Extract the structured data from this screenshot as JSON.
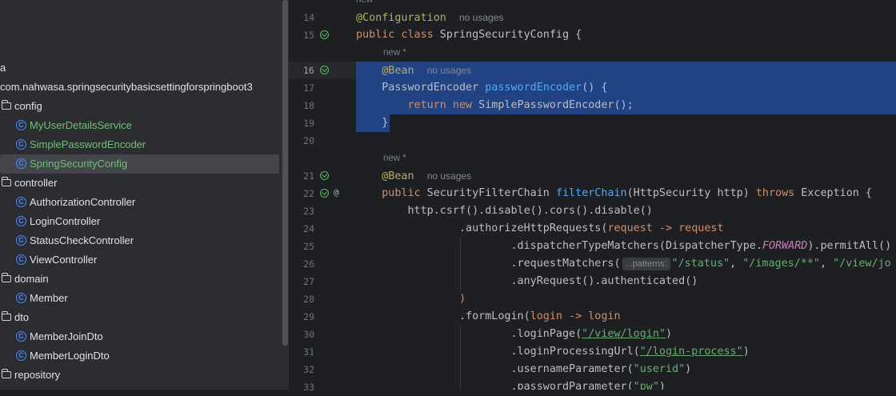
{
  "project_tree": {
    "root_fragment": "a",
    "package": "com.nahwasa.springsecuritybasicsettingforspringboot3",
    "items": [
      {
        "kind": "folder",
        "label": "config"
      },
      {
        "kind": "class",
        "label": "MyUserDetailsService",
        "color": "#73bd79"
      },
      {
        "kind": "class",
        "label": "SimplePasswordEncoder",
        "color": "#73bd79"
      },
      {
        "kind": "class",
        "label": "SpringSecurityConfig",
        "color": "#73bd79",
        "selected": true
      },
      {
        "kind": "folder",
        "label": "controller"
      },
      {
        "kind": "class",
        "label": "AuthorizationController"
      },
      {
        "kind": "class",
        "label": "LoginController"
      },
      {
        "kind": "class",
        "label": "StatusCheckController"
      },
      {
        "kind": "class",
        "label": "ViewController"
      },
      {
        "kind": "folder",
        "label": "domain"
      },
      {
        "kind": "class",
        "label": "Member"
      },
      {
        "kind": "folder",
        "label": "dto"
      },
      {
        "kind": "class",
        "label": "MemberJoinDto"
      },
      {
        "kind": "class",
        "label": "MemberLoginDto"
      },
      {
        "kind": "folder",
        "label": "repository"
      }
    ]
  },
  "editor": {
    "line_numbers": [
      "14",
      "15",
      "16",
      "17",
      "18",
      "19",
      "20",
      "21",
      "22",
      "23",
      "24",
      "25",
      "26",
      "27",
      "28",
      "29",
      "30",
      "31",
      "32",
      "33"
    ],
    "current_line": "16",
    "hints": {
      "new_top": "new *",
      "new_star_1": "new *",
      "new_star_2": "new *",
      "no_usages": "no usages",
      "patterns": "...patterns:"
    },
    "code": {
      "l14": "@Configuration",
      "l15_kw": "public class",
      "l15_name": " SpringSecurityConfig {",
      "l16": "@Bean",
      "l17_type": "PasswordEncoder ",
      "l17_fn": "passwordEncoder",
      "l17_rest": "() {",
      "l18_kw": "return new",
      "l18_rest": " SimplePasswordEncoder();",
      "l19": "}",
      "l21": "@Bean",
      "l22_kw": "public",
      "l22_type": " SecurityFilterChain ",
      "l22_fn": "filterChain",
      "l22_rest1": "(HttpSecurity ",
      "l22_param": "http",
      "l22_rest2": ") ",
      "l22_throws": "throws",
      "l22_rest3": " Exception {",
      "l23": "http.csrf().disable().cors().disable()",
      "l24_a": ".authorizeHttpRequests(",
      "l24_b": "request -> request",
      "l25_a": ".dispatcherTypeMatchers(DispatcherType.",
      "l25_enum": "FORWARD",
      "l25_b": ").permitAll()",
      "l26_a": ".requestMatchers(",
      "l26_s1": "\"/status\"",
      "l26_sep1": ", ",
      "l26_s2": "\"/images/**\"",
      "l26_sep2": ", ",
      "l26_s3": "\"/view/jo",
      "l27": ".anyRequest().authenticated()",
      "l28": ")",
      "l29_a": ".formLogin(",
      "l29_b": "login -> login",
      "l30_a": ".loginPage(",
      "l30_s": "\"/view/login\"",
      "l30_b": ")",
      "l31_a": ".loginProcessingUrl(",
      "l31_s": "\"/login-process\"",
      "l31_b": ")",
      "l32_a": ".usernameParameter(",
      "l32_s": "\"userid\"",
      "l32_b": ")",
      "l33_a": ".passwordParameter(",
      "l33_s": "\"pw\"",
      "l33_b": ")"
    }
  },
  "icons": {
    "folder": "folder-icon",
    "class": "class-icon",
    "gutter": "implement-bean-icon",
    "at": "at-icon"
  },
  "colors": {
    "selection": "#214283",
    "panel_bg": "#2b2d30",
    "editor_bg": "#1e1f22",
    "keyword": "#cf8e6d",
    "annotation": "#b3ae60",
    "function": "#56a8f5",
    "string": "#6aab73"
  }
}
